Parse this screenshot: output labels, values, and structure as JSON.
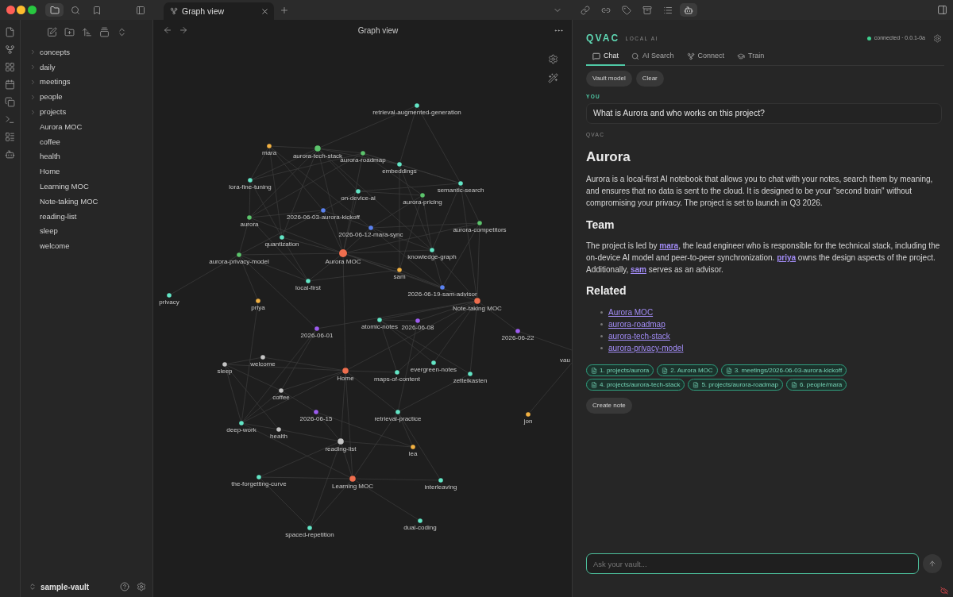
{
  "top_bar": {
    "left_buttons": [
      {
        "selected": true
      },
      {
        "selected": false
      },
      {
        "selected": false
      }
    ],
    "tabs": [
      {
        "label": "Graph view",
        "selected": true
      }
    ],
    "right_buttons": [
      {
        "selected": false
      },
      {
        "selected": false
      },
      {
        "selected": false
      },
      {
        "selected": false
      },
      {
        "selected": false
      },
      {
        "selected": true
      }
    ]
  },
  "sidebar": {
    "folders": [
      {
        "label": "concepts",
        "expanded": false
      },
      {
        "label": "daily",
        "expanded": false
      },
      {
        "label": "meetings",
        "expanded": false
      },
      {
        "label": "people",
        "expanded": false
      },
      {
        "label": "projects",
        "expanded": false
      }
    ],
    "files": [
      {
        "label": "Aurora MOC"
      },
      {
        "label": "coffee"
      },
      {
        "label": "health"
      },
      {
        "label": "Home"
      },
      {
        "label": "Learning MOC"
      },
      {
        "label": "Note-taking MOC"
      },
      {
        "label": "reading-list"
      },
      {
        "label": "sleep"
      },
      {
        "label": "welcome"
      }
    ],
    "vault": "sample-vault"
  },
  "graph_view": {
    "title": "Graph view",
    "nodes": [
      {
        "label": "retrieval-augmented-generation",
        "color": "#63e6c6",
        "kind": "note"
      },
      {
        "label": "mara",
        "color": "#f2b142",
        "kind": "note"
      },
      {
        "label": "aurora-tech-stack",
        "color": "#5cc46c",
        "kind": "major"
      },
      {
        "label": "aurora-roadmap",
        "color": "#5cc46c",
        "kind": "note"
      },
      {
        "label": "embeddings",
        "color": "#63e6c6",
        "kind": "note"
      },
      {
        "label": "lora-fine-tuning",
        "color": "#63e6c6",
        "kind": "note"
      },
      {
        "label": "semantic-search",
        "color": "#63e6c6",
        "kind": "note"
      },
      {
        "label": "on-device-ai",
        "color": "#63e6c6",
        "kind": "note"
      },
      {
        "label": "aurora-pricing",
        "color": "#5cc46c",
        "kind": "note"
      },
      {
        "label": "2026-06-03-aurora-kickoff",
        "color": "#5a82f0",
        "kind": "note"
      },
      {
        "label": "aurora",
        "color": "#5cc46c",
        "kind": "note"
      },
      {
        "label": "2026-06-12-mara-sync",
        "color": "#5a82f0",
        "kind": "note"
      },
      {
        "label": "aurora-competitors",
        "color": "#5cc46c",
        "kind": "note"
      },
      {
        "label": "quantization",
        "color": "#63e6c6",
        "kind": "note"
      },
      {
        "label": "Aurora MOC",
        "color": "#ef6e4e",
        "kind": "hub"
      },
      {
        "label": "aurora-privacy-model",
        "color": "#5cc46c",
        "kind": "note"
      },
      {
        "label": "knowledge-graph",
        "color": "#63e6c6",
        "kind": "note"
      },
      {
        "label": "sam",
        "color": "#f2b142",
        "kind": "note"
      },
      {
        "label": "local-first",
        "color": "#63e6c6",
        "kind": "note"
      },
      {
        "label": "2026-06-19-sam-advisor",
        "color": "#5a82f0",
        "kind": "note"
      },
      {
        "label": "privacy",
        "color": "#63e6c6",
        "kind": "note"
      },
      {
        "label": "priya",
        "color": "#f2b142",
        "kind": "note"
      },
      {
        "label": "Note-taking MOC",
        "color": "#ef6e4e",
        "kind": "major"
      },
      {
        "label": "2026-06-01",
        "color": "#9d5cf0",
        "kind": "note"
      },
      {
        "label": "atomic-notes",
        "color": "#63e6c6",
        "kind": "note"
      },
      {
        "label": "2026-06-08",
        "color": "#9d5cf0",
        "kind": "note"
      },
      {
        "label": "2026-06-22",
        "color": "#9d5cf0",
        "kind": "note"
      },
      {
        "label": "welcome",
        "color": "#c4c4c4",
        "kind": "note"
      },
      {
        "label": "sleep",
        "color": "#c4c4c4",
        "kind": "note"
      },
      {
        "label": "Home",
        "color": "#ef6e4e",
        "kind": "major"
      },
      {
        "label": "maps-of-content",
        "color": "#63e6c6",
        "kind": "note"
      },
      {
        "label": "evergreen-notes",
        "color": "#63e6c6",
        "kind": "note"
      },
      {
        "label": "zettelkasten",
        "color": "#63e6c6",
        "kind": "note"
      },
      {
        "label": "coffee",
        "color": "#c4c4c4",
        "kind": "note"
      },
      {
        "label": "2026-06-15",
        "color": "#9d5cf0",
        "kind": "note"
      },
      {
        "label": "retrieval-practice",
        "color": "#63e6c6",
        "kind": "note"
      },
      {
        "label": "jon",
        "color": "#f2b142",
        "kind": "note"
      },
      {
        "label": "deep-work",
        "color": "#63e6c6",
        "kind": "note"
      },
      {
        "label": "health",
        "color": "#c4c4c4",
        "kind": "note"
      },
      {
        "label": "reading-list",
        "color": "#c4c4c4",
        "kind": "major"
      },
      {
        "label": "lea",
        "color": "#f2b142",
        "kind": "note"
      },
      {
        "label": "the-forgetting-curve",
        "color": "#63e6c6",
        "kind": "note"
      },
      {
        "label": "Learning MOC",
        "color": "#ef6e4e",
        "kind": "major"
      },
      {
        "label": "interleaving",
        "color": "#63e6c6",
        "kind": "note"
      },
      {
        "label": "dual-coding",
        "color": "#63e6c6",
        "kind": "note"
      },
      {
        "label": "spaced-repetition",
        "color": "#63e6c6",
        "kind": "note"
      }
    ],
    "cut_off_label": "vau"
  },
  "assistant": {
    "brand": "QVAC",
    "subtitle": "LOCAL AI",
    "status": "connected · 0.0.1-0a",
    "connected": true,
    "tabs": [
      {
        "label": "Chat",
        "selected": true
      },
      {
        "label": "AI Search",
        "selected": false
      },
      {
        "label": "Connect",
        "selected": false
      },
      {
        "label": "Train",
        "selected": false
      }
    ],
    "actions": [
      "Vault model",
      "Clear"
    ],
    "question_label": "YOU",
    "question": "What is Aurora and who works on this project?",
    "answer_label": "QVAC",
    "answer": {
      "title": "Aurora",
      "intro": "Aurora is a local-first AI notebook that allows you to chat with your notes, search them by meaning, and ensures that no data is sent to the cloud. It is designed to be your \"second brain\" without compromising your privacy. The project is set to launch in Q3 2026.",
      "team_heading": "Team",
      "team_segments": [
        {
          "kind": "text",
          "text": "The project is led by "
        },
        {
          "kind": "link",
          "text": "mara"
        },
        {
          "kind": "text",
          "text": ", the lead engineer who is responsible for the technical stack, including the on-device AI model and peer-to-peer synchronization. "
        },
        {
          "kind": "link",
          "text": "priya"
        },
        {
          "kind": "text",
          "text": " owns the design aspects of the project. Additionally, "
        },
        {
          "kind": "link",
          "text": "sam"
        },
        {
          "kind": "text",
          "text": " serves as an advisor."
        }
      ],
      "related_heading": "Related",
      "related": [
        "Aurora MOC",
        "aurora-roadmap",
        "aurora-tech-stack",
        "aurora-privacy-model"
      ]
    },
    "sources": [
      "1. projects/aurora",
      "2. Aurora MOC",
      "3. meetings/2026-06-03-aurora-kickoff",
      "4. projects/aurora-tech-stack",
      "5. projects/aurora-roadmap",
      "6. people/mara"
    ],
    "create_note": "Create note",
    "input": {
      "placeholder": "Ask your vault..."
    }
  }
}
